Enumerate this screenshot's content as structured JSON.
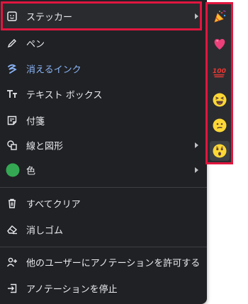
{
  "menu": {
    "items": [
      {
        "label": "ステッカー",
        "icon": "sticker-icon",
        "submenu": true
      },
      {
        "label": "ペン",
        "icon": "pen-icon"
      },
      {
        "label": "消えるインク",
        "icon": "laser-ink-icon"
      },
      {
        "label": "テキスト ボックス",
        "icon": "text-box-icon"
      },
      {
        "label": "付箋",
        "icon": "sticky-note-icon"
      },
      {
        "label": "線と図形",
        "icon": "shapes-icon",
        "submenu": true
      },
      {
        "label": "色",
        "icon": "color-swatch",
        "submenu": true,
        "color": "#34a853"
      },
      {
        "label": "すべてクリア",
        "icon": "trash-icon"
      },
      {
        "label": "消しゴム",
        "icon": "eraser-icon"
      },
      {
        "label": "他のユーザーにアノテーションを許可する",
        "icon": "person-add-icon"
      },
      {
        "label": "アノテーションを停止",
        "icon": "exit-icon"
      }
    ],
    "accent_blue": "#8ab4f8",
    "highlight_color": "#e0173f"
  },
  "stickers": [
    {
      "name": "party-popper",
      "glyph": "🎊"
    },
    {
      "name": "pink-heart",
      "glyph": "💗"
    },
    {
      "name": "hundred-points",
      "glyph": "💯"
    },
    {
      "name": "grinning-squinting-face",
      "glyph": "😆"
    },
    {
      "name": "confused-face",
      "glyph": "😕"
    },
    {
      "name": "astonished-face",
      "glyph": "😲"
    }
  ]
}
